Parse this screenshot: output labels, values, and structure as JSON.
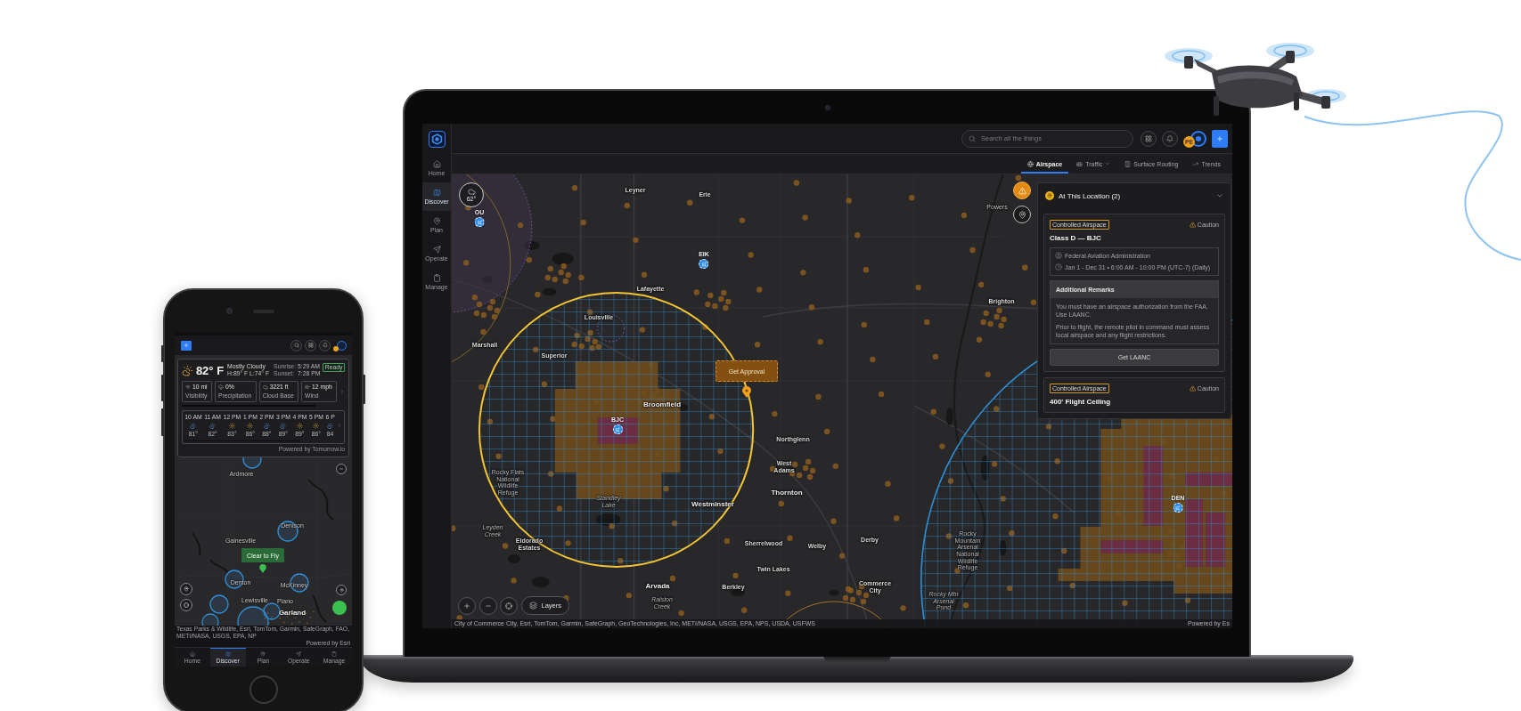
{
  "laptop": {
    "search": {
      "placeholder": "Search all the things"
    },
    "avatar_badge": "PE",
    "sidebar": [
      {
        "label": "Home",
        "selected": false
      },
      {
        "label": "Discover",
        "selected": true
      },
      {
        "label": "Plan",
        "selected": false
      },
      {
        "label": "Operate",
        "selected": false
      },
      {
        "label": "Manage",
        "selected": false
      }
    ],
    "tabs": [
      {
        "label": "Airspace",
        "selected": true,
        "has_menu": false
      },
      {
        "label": "Traffic",
        "selected": false,
        "has_menu": true
      },
      {
        "label": "Surface Routing",
        "selected": false,
        "has_menu": false
      },
      {
        "label": "Trends",
        "selected": false,
        "has_menu": false
      }
    ],
    "weather": {
      "temperature": "62°"
    },
    "airports": [
      {
        "code": "OU"
      },
      {
        "code": "EIK"
      },
      {
        "code": "BJC"
      },
      {
        "code": "DEN"
      }
    ],
    "map_labels": [
      {
        "text": "Leyner",
        "kind": "town"
      },
      {
        "text": "Erie",
        "kind": "town"
      },
      {
        "text": "Powers",
        "kind": "small"
      },
      {
        "text": "Lafayette",
        "kind": "town"
      },
      {
        "text": "Brighton",
        "kind": "town"
      },
      {
        "text": "Louisville",
        "kind": "town"
      },
      {
        "text": "Marshall",
        "kind": "town"
      },
      {
        "text": "Superior",
        "kind": "town"
      },
      {
        "text": "Broomfield",
        "kind": "city"
      },
      {
        "text": "Northglenn",
        "kind": "town"
      },
      {
        "text": "West Adams",
        "kind": "stacked"
      },
      {
        "text": "Rocky Flats National Wildlife Refuge",
        "kind": "area"
      },
      {
        "text": "Thornton",
        "kind": "city"
      },
      {
        "text": "Standley Lake",
        "kind": "water"
      },
      {
        "text": "Westminster",
        "kind": "city"
      },
      {
        "text": "Leyden Creek",
        "kind": "water"
      },
      {
        "text": "Eldorado Estates",
        "kind": "stacked"
      },
      {
        "text": "Sherrelwood",
        "kind": "town"
      },
      {
        "text": "Welby",
        "kind": "town"
      },
      {
        "text": "Derby",
        "kind": "town"
      },
      {
        "text": "Twin Lakes",
        "kind": "town"
      },
      {
        "text": "Rocky Mountain Arsenal National Wildlife Refuge",
        "kind": "area"
      },
      {
        "text": "Arvada",
        "kind": "city"
      },
      {
        "text": "Berkley",
        "kind": "town"
      },
      {
        "text": "Commerce City",
        "kind": "stacked"
      },
      {
        "text": "Ralston Creek",
        "kind": "water"
      },
      {
        "text": "Rocky Mtn Arsenal Pond",
        "kind": "water"
      }
    ],
    "approval": {
      "label": "Get Approval"
    },
    "panel": {
      "title": "At This Location (2)",
      "cards": [
        {
          "tag": "Controlled Airspace",
          "status": "Caution",
          "title": "Class D — BJC",
          "authority": "Federal Aviation Administration",
          "schedule": "Jan 1 - Dec 31 • 6:00 AM - 10:00 PM (UTC-7) (Daily)",
          "remarks": {
            "title": "Additional Remarks",
            "paragraphs": [
              "You must have an airspace authorization from the FAA. Use LAANC.",
              "Prior to flight, the remote pilot in command must assess local airspace and any flight restrictions."
            ]
          },
          "action": "Get LAANC"
        },
        {
          "tag": "Controlled Airspace",
          "status": "Caution",
          "title": "400' Flight Ceiling"
        }
      ]
    },
    "layers": "Layers",
    "attribution": "City of Commerce City, Esri, TomTom, Garmin, SafeGraph, GeoTechnologies, Inc, METI/NASA, USGS, EPA, NPS, USDA, USFWS",
    "powered_by": "Powered by Es"
  },
  "phone": {
    "weather": {
      "temperature": "82° F",
      "condition": "Mostly Cloudy",
      "high_low": "H:89° F L:74° F",
      "sun": [
        {
          "label": "Sunrise:",
          "time": "5:29 AM"
        },
        {
          "label": "Sunset:",
          "time": "7:28 PM"
        }
      ],
      "status": "Ready",
      "stats": [
        {
          "value": "10 mi",
          "label": "Visibility"
        },
        {
          "value": "0%",
          "label": "Precipitation"
        },
        {
          "value": "3221 ft",
          "label": "Cloud Base"
        },
        {
          "value": "12 mph",
          "label": "Wind"
        }
      ],
      "hourly": [
        {
          "time": "10 AM",
          "kind": "partly_cloudy",
          "temperature": "81°"
        },
        {
          "time": "11 AM",
          "kind": "partly_cloudy",
          "temperature": "82°"
        },
        {
          "time": "12 PM",
          "kind": "sunny",
          "temperature": "83°"
        },
        {
          "time": "1 PM",
          "kind": "sunny",
          "temperature": "86°"
        },
        {
          "time": "2 PM",
          "kind": "partly_cloudy",
          "temperature": "88°"
        },
        {
          "time": "3 PM",
          "kind": "partly_cloudy",
          "temperature": "89°"
        },
        {
          "time": "4 PM",
          "kind": "sunny",
          "temperature": "89°"
        },
        {
          "time": "5 PM",
          "kind": "sunny",
          "temperature": "86°"
        },
        {
          "time": "6 P",
          "kind": "partly_cloudy",
          "temperature": "84"
        }
      ],
      "credit": "Powered by Tomorrow.io"
    },
    "map_labels": [
      {
        "text": "Ardmore",
        "kind": "town"
      },
      {
        "text": "Denison",
        "kind": "town"
      },
      {
        "text": "Gainesville",
        "kind": "town"
      },
      {
        "text": "Denton",
        "kind": "town"
      },
      {
        "text": "McKinney",
        "kind": "town"
      },
      {
        "text": "Lewisville",
        "kind": "town"
      },
      {
        "text": "Plano",
        "kind": "town"
      },
      {
        "text": "Garland",
        "kind": "city"
      }
    ],
    "status_label": "Clear to Fly",
    "attribution": "Texas Parks & Wildlife, Esri, TomTom, Garmin, SafeGraph, FAO, METI/NASA, USGS, EPA, NP",
    "powered_by": "Powered by Esri",
    "nav": [
      {
        "label": "Home",
        "selected": false
      },
      {
        "label": "Discover",
        "selected": true
      },
      {
        "label": "Plan",
        "selected": false
      },
      {
        "label": "Operate",
        "selected": false
      },
      {
        "label": "Manage",
        "selected": false
      }
    ]
  }
}
